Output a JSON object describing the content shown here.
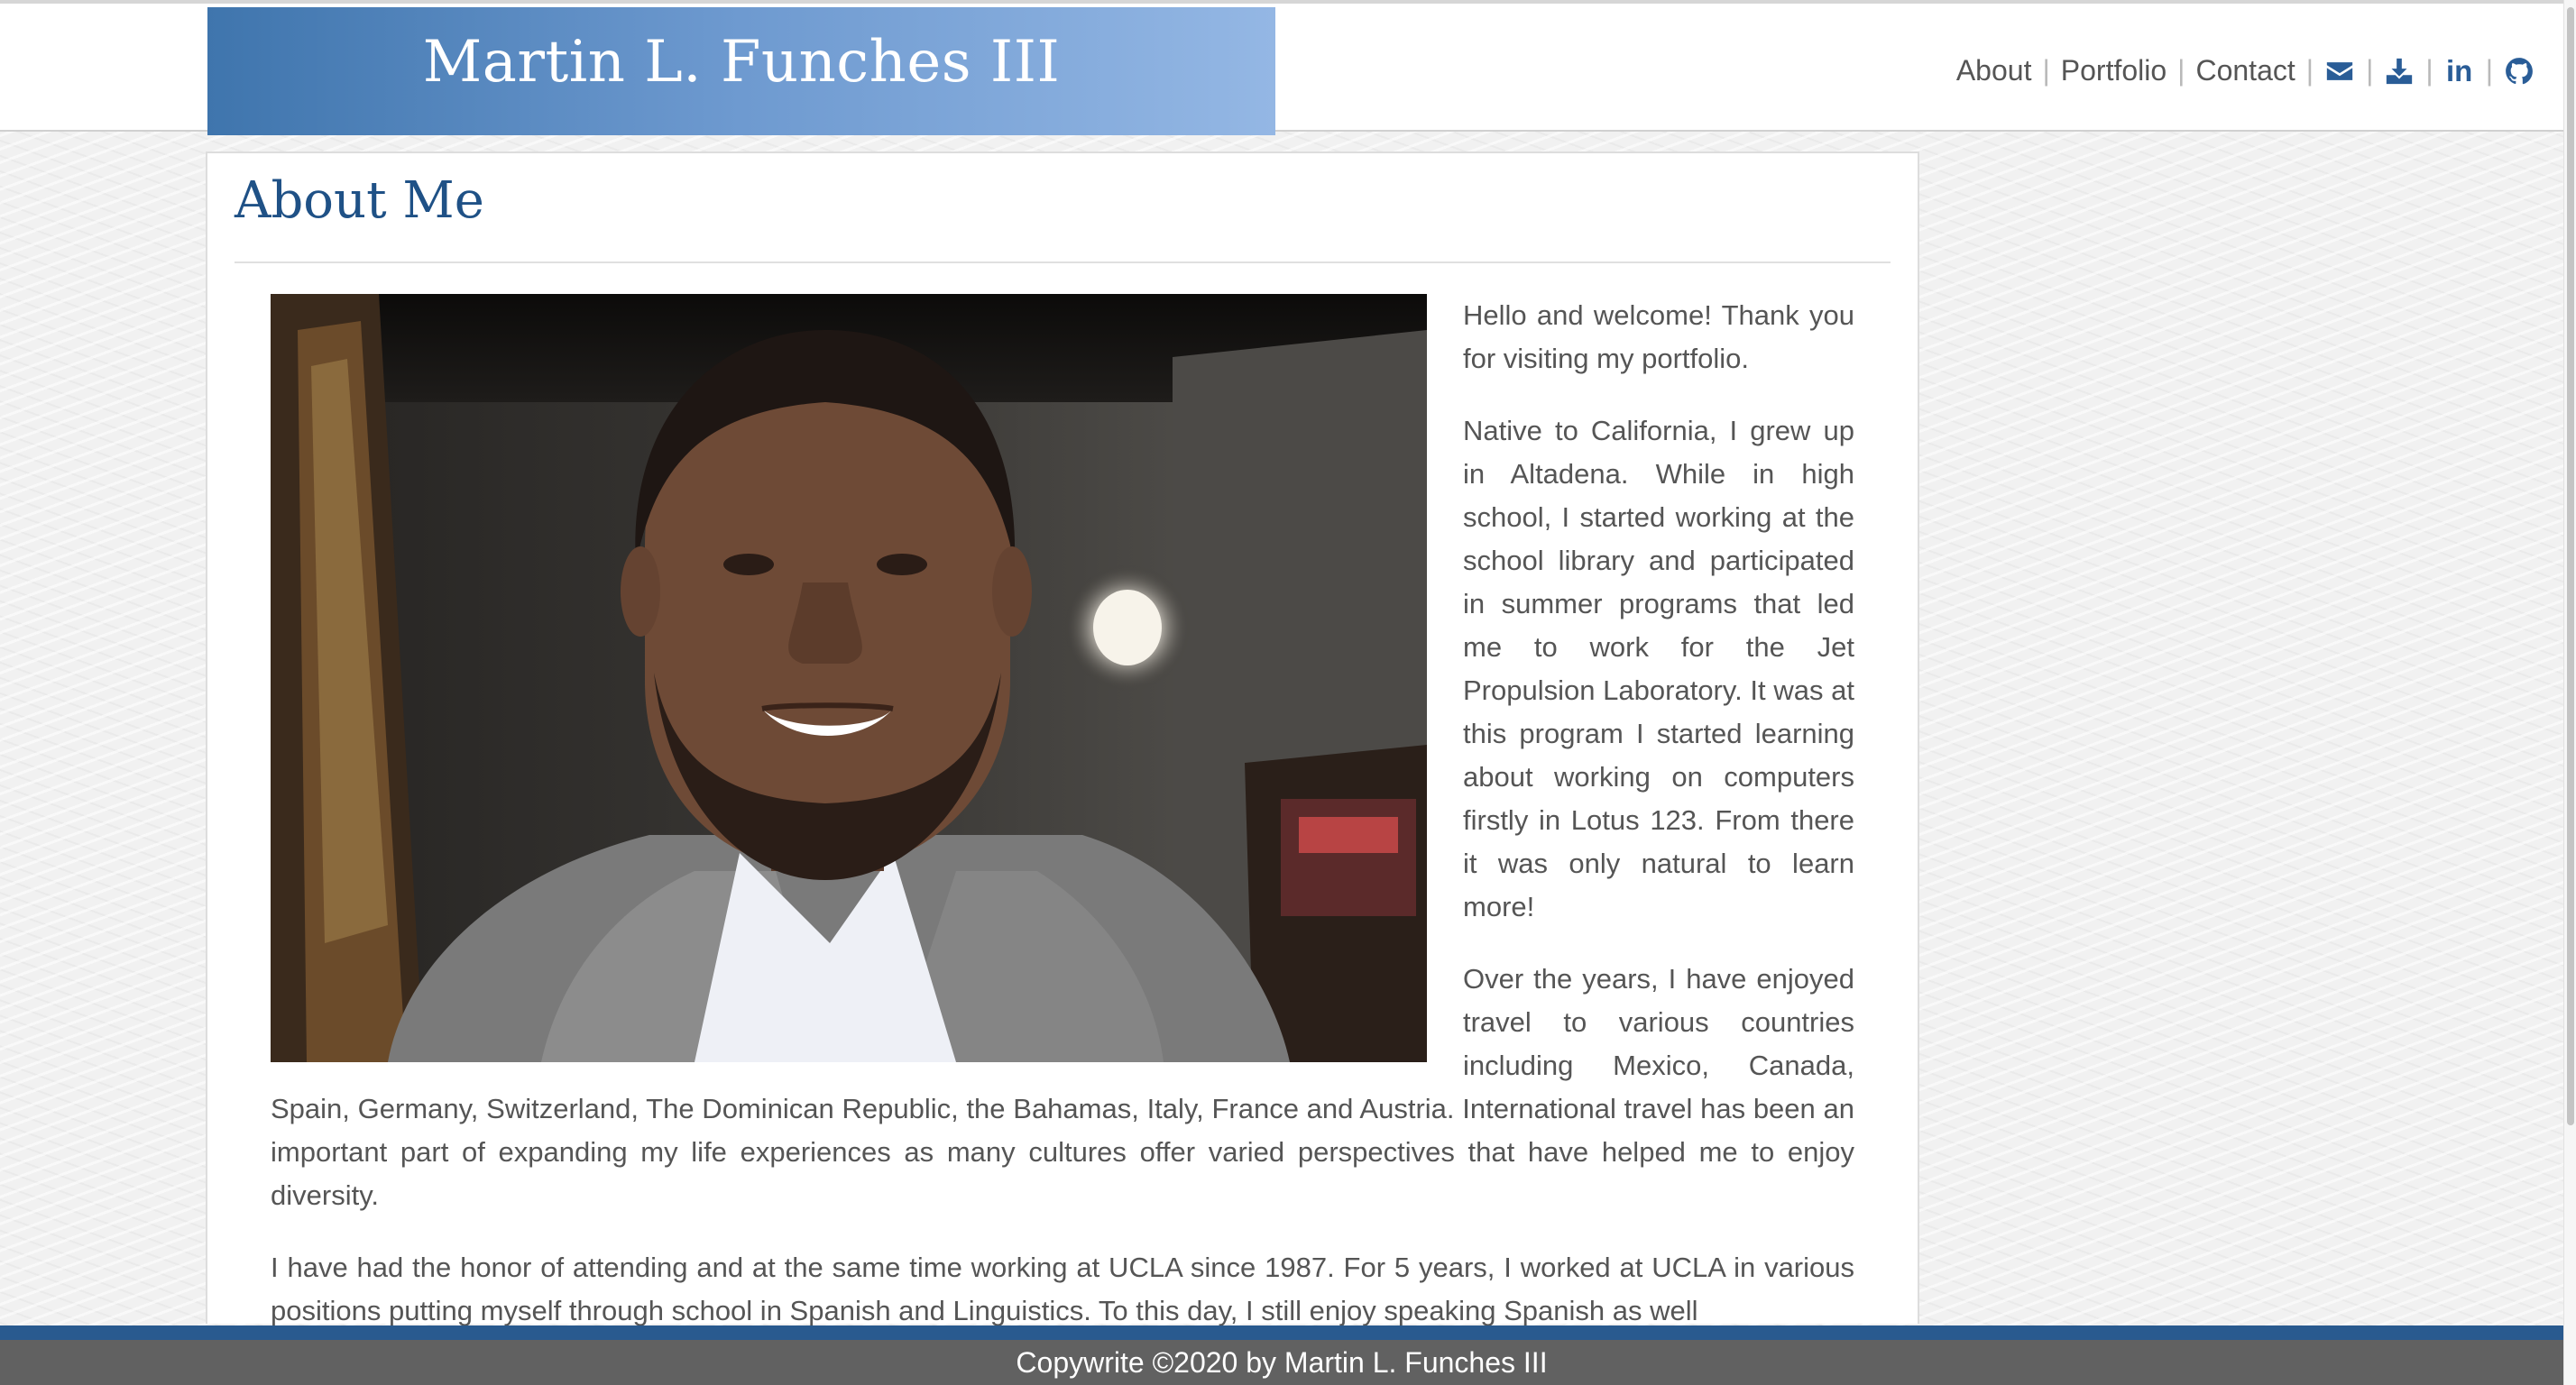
{
  "header": {
    "site_title": "Martin L. Funches III",
    "nav": {
      "about": "About",
      "portfolio": "Portfolio",
      "contact": "Contact",
      "separator": "|",
      "linkedin_text": "in"
    },
    "icons": [
      "envelope-icon",
      "download-icon",
      "linkedin-icon",
      "github-icon"
    ],
    "brand_gradient": [
      "#3f75ad",
      "#94b7e4"
    ],
    "accent_color": "#2a5d97"
  },
  "main": {
    "title": "About Me",
    "paragraphs": [
      "Hello and welcome! Thank you for visiting my portfolio.",
      "Native to California, I grew up in Altadena. While in high school, I started working at the school library and participated in summer programs that led me to work for the Jet Propulsion Laboratory. It was at this program I started learning about working on computers firstly in Lotus 123. From there it was only natural to learn more!",
      "Over the years, I have enjoyed travel to various countries including Mexico, Canada, Spain, Germany, Switzerland, The Dominican Republic, the Bahamas, Italy, France and Austria. International travel has been an important part of expanding my life experiences as many cultures offer varied perspectives that have helped me to enjoy diversity.",
      "I have had the honor of attending and at the same time working at UCLA since 1987. For 5 years, I worked at UCLA in various positions putting myself through school in Spanish and Linguistics. To this day, I still enjoy speaking Spanish as well"
    ]
  },
  "footer": {
    "text": "Copywrite ©2020 by Martin L. Funches III",
    "bar_color": "#295a8f",
    "bg_color": "#616161"
  }
}
